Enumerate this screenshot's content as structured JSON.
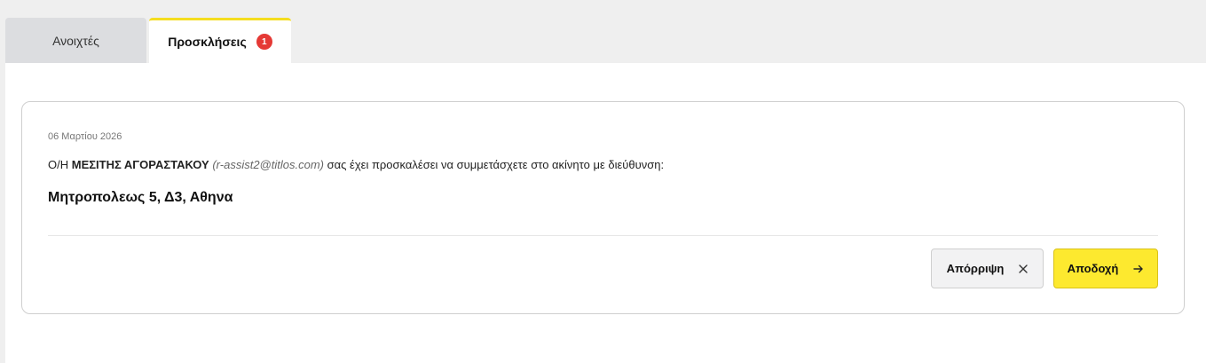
{
  "tabs": [
    {
      "label": "Ανοιχτές",
      "active": false
    },
    {
      "label": "Προσκλήσεις",
      "active": true,
      "badge": "1"
    }
  ],
  "invitation": {
    "date": "06 Μαρτίου 2026",
    "prefix": "Ο/Η",
    "inviter_name": "ΜΕΣΙΤΗΣ ΑΓΟΡΑΣΤΑΚΟΥ",
    "inviter_email": "(r-assist2@titlos.com)",
    "message_suffix": "σας έχει προσκαλέσει να συμμετάσχετε στο ακίνητο με διεύθυνση:",
    "address": "Μητροπολεως 5, Δ3, Αθηνα"
  },
  "actions": {
    "reject_label": "Απόρριψη",
    "reject_icon": "close-icon",
    "accept_label": "Αποδοχή",
    "accept_icon": "arrow-right-icon"
  },
  "colors": {
    "accent_yellow": "#fde92f",
    "badge_red": "#e53935",
    "tab_inactive_bg": "#dcdde0"
  }
}
